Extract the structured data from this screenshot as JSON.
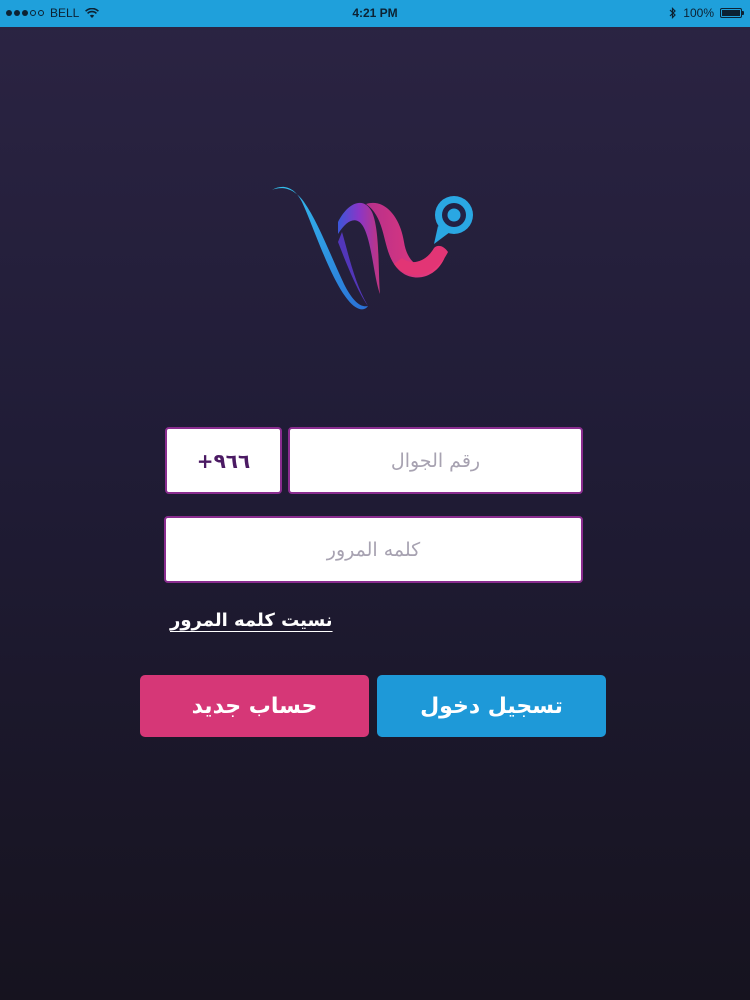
{
  "status_bar": {
    "carrier": "BELL",
    "time": "4:21 PM",
    "battery": "100%",
    "battery_level": 1.0,
    "signal_bars_filled": 3,
    "signal_bars_total": 5,
    "icons": [
      "wifi-icon",
      "bluetooth-icon",
      "battery-icon"
    ],
    "background_color": "#1fa0db"
  },
  "logo": {
    "icon": "app-logo-w-location-pin"
  },
  "login_form": {
    "country_code": "+٩٦٦",
    "phone_placeholder": "رقم الجوال",
    "phone_value": "",
    "password_placeholder": "كلمه المرور",
    "password_value": "",
    "forgot_password": "نسيت كلمه المرور"
  },
  "actions": {
    "register_label": "حساب جديد",
    "login_label": "تسجيل دخول"
  },
  "colors": {
    "background_top": "#2b2443",
    "background_bottom": "#16131f",
    "field_border": "#8a2d8f",
    "register_button": "#d63777",
    "login_button": "#1e99d8"
  }
}
